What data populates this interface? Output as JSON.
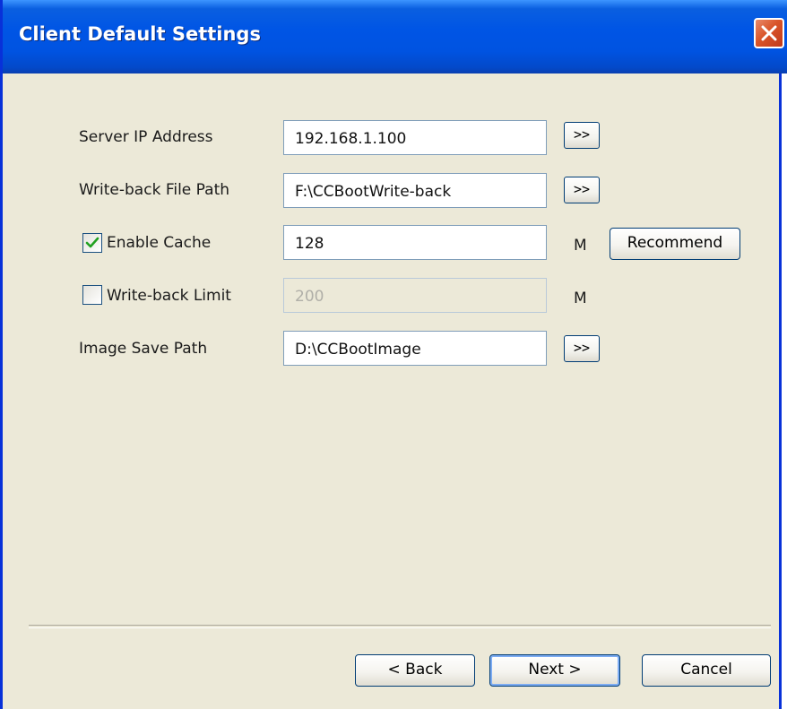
{
  "window": {
    "title": "Client Default Settings",
    "close_icon": "close-icon"
  },
  "form": {
    "server_ip": {
      "label": "Server IP Address",
      "value": "192.168.1.100",
      "browse_label": ">>"
    },
    "writeback_path": {
      "label": "Write-back File Path",
      "value": "F:\\CCBootWrite-back",
      "browse_label": ">>"
    },
    "enable_cache": {
      "label": "Enable Cache",
      "checked": true,
      "value": "128",
      "unit": "M",
      "recommend_label": "Recommend"
    },
    "writeback_limit": {
      "label": "Write-back Limit",
      "checked": false,
      "value": "200",
      "unit": "M"
    },
    "image_save_path": {
      "label": "Image Save Path",
      "value": "D:\\CCBootImage",
      "browse_label": ">>"
    }
  },
  "footer": {
    "back_label": "< Back",
    "next_label": "Next >",
    "cancel_label": "Cancel"
  },
  "colors": {
    "title_bar": "#0055e5",
    "dialog_bg": "#ece9d8",
    "close_button": "#d9552a",
    "checkmark": "#21a121"
  }
}
